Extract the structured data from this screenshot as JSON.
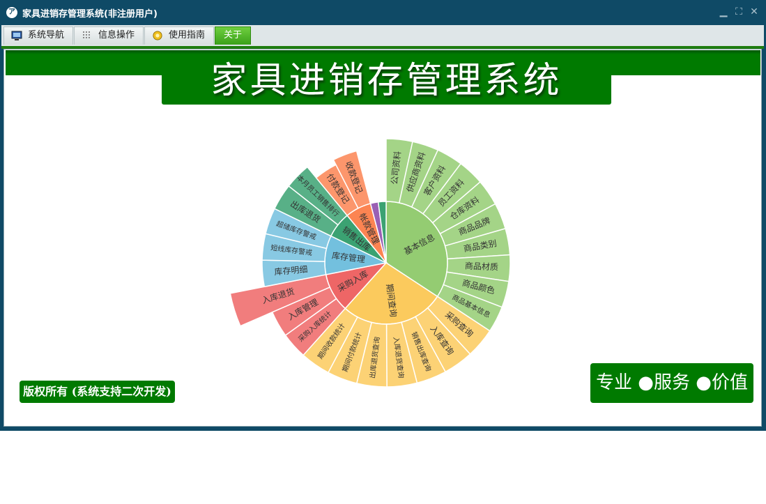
{
  "window": {
    "title": "家具进销存管理系统(非注册用户)",
    "app_icon_glyph": "ア",
    "controls": {
      "minimize": "▁",
      "restore": "⛶",
      "close": "✕"
    }
  },
  "tabs": [
    {
      "label": "系统导航",
      "icon": "monitor-icon",
      "active": false
    },
    {
      "label": "信息操作",
      "icon": "grid-icon",
      "active": false
    },
    {
      "label": "使用指南",
      "icon": "help-icon",
      "active": false
    },
    {
      "label": "关于",
      "icon": "",
      "active": true
    }
  ],
  "banner": {
    "title": "家具进销存管理系统"
  },
  "footer": {
    "copyright": "版权所有 (系统支持二次开发)",
    "slogan": "专业 ●服务 ●价值"
  },
  "colors": {
    "brand_green": "#007a00",
    "window_frame": "#0f4a66"
  },
  "chart_data": {
    "type": "sunburst",
    "categories": [
      {
        "name": "基本信息",
        "color": "#94cc72",
        "value": 10,
        "children": [
          "公司资料",
          "供应商资料",
          "客户资料",
          "员工资料",
          "仓库资料",
          "商品品牌",
          "商品类别",
          "商品材质",
          "商品颜色",
          "商品基本信息"
        ]
      },
      {
        "name": "期间查询",
        "color": "#fbca5d",
        "value": 8,
        "children": [
          "采购查询",
          "入库查询",
          "销售出库查询",
          "入库退货查询",
          "出库退货查询",
          "期间付款统计",
          "期间收款统计"
        ]
      },
      {
        "name": "采购入库",
        "color": "#ee6666",
        "value": 3,
        "children": [
          "采购入库统计",
          "入库管理",
          "入库退货"
        ]
      },
      {
        "name": "库存管理",
        "color": "#73c0de",
        "value": 3,
        "children": [
          "库存明细",
          "短线库存警戒",
          "超储库存警戒"
        ]
      },
      {
        "name": "销售出库",
        "color": "#3ba272",
        "value": 2,
        "children": [
          "出库退货",
          "本月员工销售排行"
        ]
      },
      {
        "name": "帐款管理",
        "color": "#fc8452",
        "value": 2,
        "children": [
          "付款登记",
          "收款登记"
        ]
      },
      {
        "name": "采购入库",
        "color": "#9a60b4",
        "value": 0.6,
        "children": []
      },
      {
        "name": "销售出库",
        "color": "#3ba272",
        "value": 0.6,
        "children": []
      }
    ]
  }
}
